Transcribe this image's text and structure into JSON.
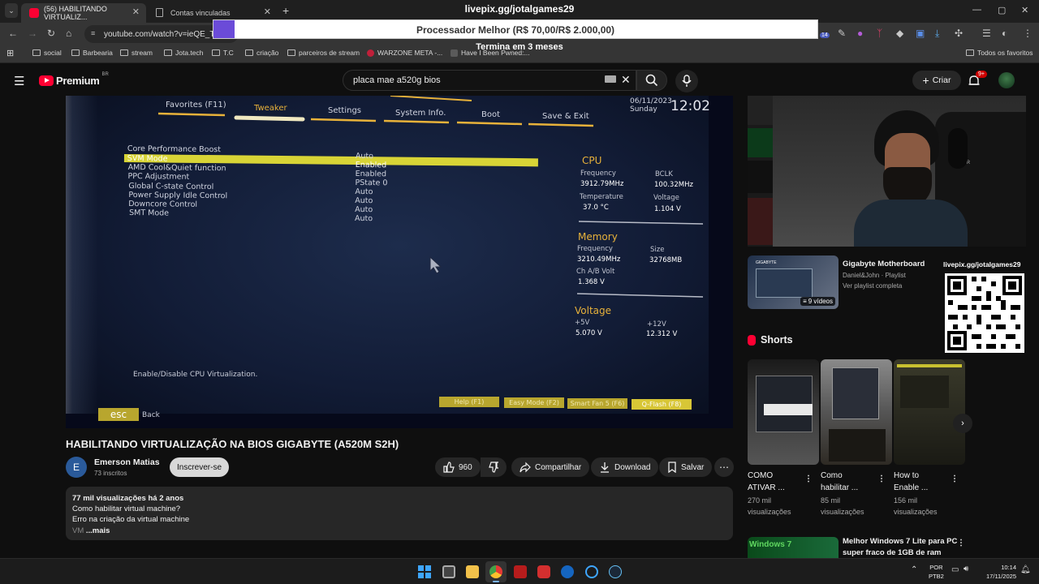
{
  "browser": {
    "tabs": [
      {
        "label": "(56) HABILITANDO VIRTUALIZ...",
        "active": true
      },
      {
        "label": "Contas vinculadas",
        "active": false
      }
    ],
    "new_tab": "+",
    "address": "youtube.com/watch?v=ieQE_TX2",
    "bookmarks": [
      "social",
      "Barbearia",
      "stream",
      "Jota.tech",
      "T.C",
      "criação",
      "parceiros de stream",
      "WARZONE META -...",
      "Have I Been Pwned:..."
    ],
    "all_favorites": "Todos os favoritos",
    "extension_badge": "14"
  },
  "overlay": {
    "title": "livepix.gg/jotalgames29",
    "goal_text": "Processador Melhor (R$ 70,00/R$ 2.000,00)",
    "goal_progress": 0.035,
    "subtitle": "Termina em 3 meses"
  },
  "youtube": {
    "logo_text": "Premium",
    "logo_region": "BR",
    "search_value": "placa mae a520g bios",
    "create_label": "Criar",
    "notif_count": "9+"
  },
  "bios": {
    "date": "06/11/2023",
    "day": "Sunday",
    "time": "12:02",
    "tabs": [
      "Favorites (F11)",
      "Tweaker",
      "Settings",
      "System Info.",
      "Boot",
      "Save & Exit"
    ],
    "active_tab": "Tweaker",
    "rows": [
      {
        "label": "Core Performance Boost",
        "value": "Auto"
      },
      {
        "label": "SVM Mode",
        "value": "Enabled"
      },
      {
        "label": "AMD Cool&Quiet function",
        "value": "Enabled"
      },
      {
        "label": "PPC Adjustment",
        "value": "PState 0"
      },
      {
        "label": "Global C-state Control",
        "value": "Auto"
      },
      {
        "label": "Power Supply Idle Control",
        "value": "Auto"
      },
      {
        "label": "Downcore Control",
        "value": "Auto"
      },
      {
        "label": "SMT Mode",
        "value": "Auto"
      }
    ],
    "cpu": {
      "title": "CPU",
      "freq_label": "Frequency",
      "freq": "3912.79MHz",
      "bclk_label": "BCLK",
      "bclk": "100.32MHz",
      "temp_label": "Temperature",
      "temp": "37.0 °C",
      "volt_label": "Voltage",
      "volt": "1.104 V"
    },
    "memory": {
      "title": "Memory",
      "freq_label": "Frequency",
      "freq": "3210.49MHz",
      "size_label": "Size",
      "size": "32768MB",
      "volt_label": "Ch A/B Volt",
      "volt": "1.368 V"
    },
    "voltage": {
      "title": "Voltage",
      "v5_label": "+5V",
      "v5": "5.070 V",
      "v12_label": "+12V",
      "v12": "12.312 V"
    },
    "help_text": "Enable/Disable CPU Virtualization.",
    "footer_buttons": [
      "Help (F1)",
      "Easy Mode (F2)",
      "Smart Fan 5 (F6)",
      "Q-Flash (F8)"
    ],
    "esc_label": "esc",
    "back_label": "Back"
  },
  "video": {
    "title": "HABILITANDO VIRTUALIZAÇÃO NA BIOS GIGABYTE (A520M S2H)",
    "channel": "Emerson Matias",
    "channel_initial": "E",
    "subscribers": "73 inscritos",
    "subscribe_label": "Inscrever-se",
    "likes": "960",
    "share_label": "Compartilhar",
    "download_label": "Download",
    "save_label": "Salvar",
    "desc_line1": "77 mil visualizações  há 2 anos",
    "desc_line2": "Como habilitar virtual machine?",
    "desc_line3": "Erro na criação da virtual machine",
    "desc_line4_a": "VM",
    "desc_more": "...mais"
  },
  "sidebar": {
    "playlist": {
      "title": "Gigabyte Motherboard",
      "author": "Daniel&John · Playlist",
      "link": "Ver playlist completa",
      "count": "9 vídeos",
      "thumb_brand": "GIGABYTE"
    },
    "qr_label": "livepix.gg/jotalgames29",
    "webcam_brand": "RACER",
    "shorts_label": "Shorts",
    "shorts": [
      {
        "title_1": "COMO",
        "title_2": "ATIVAR ...",
        "views_1": "270 mil",
        "views_2": "visualizações"
      },
      {
        "title_1": "Como",
        "title_2": "habilitar ...",
        "views_1": "85 mil",
        "views_2": "visualizações"
      },
      {
        "title_1": "How to",
        "title_2": "Enable ...",
        "views_1": "156 mil",
        "views_2": "visualizações"
      }
    ],
    "next_video": {
      "thumb_text": "Windows 7",
      "title_1": "Melhor Windows 7 Lite para PC",
      "title_2": "super fraco de 1GB de ram"
    }
  },
  "taskbar": {
    "lang_1": "POR",
    "lang_2": "PTB2",
    "time": "10:14",
    "date": "17/11/2025"
  },
  "colors": {
    "bios_yellow": "#d8d436",
    "bios_orange": "#e8b23a",
    "yt_red": "#ff0033",
    "overlay_purple": "#6b4bd8"
  }
}
